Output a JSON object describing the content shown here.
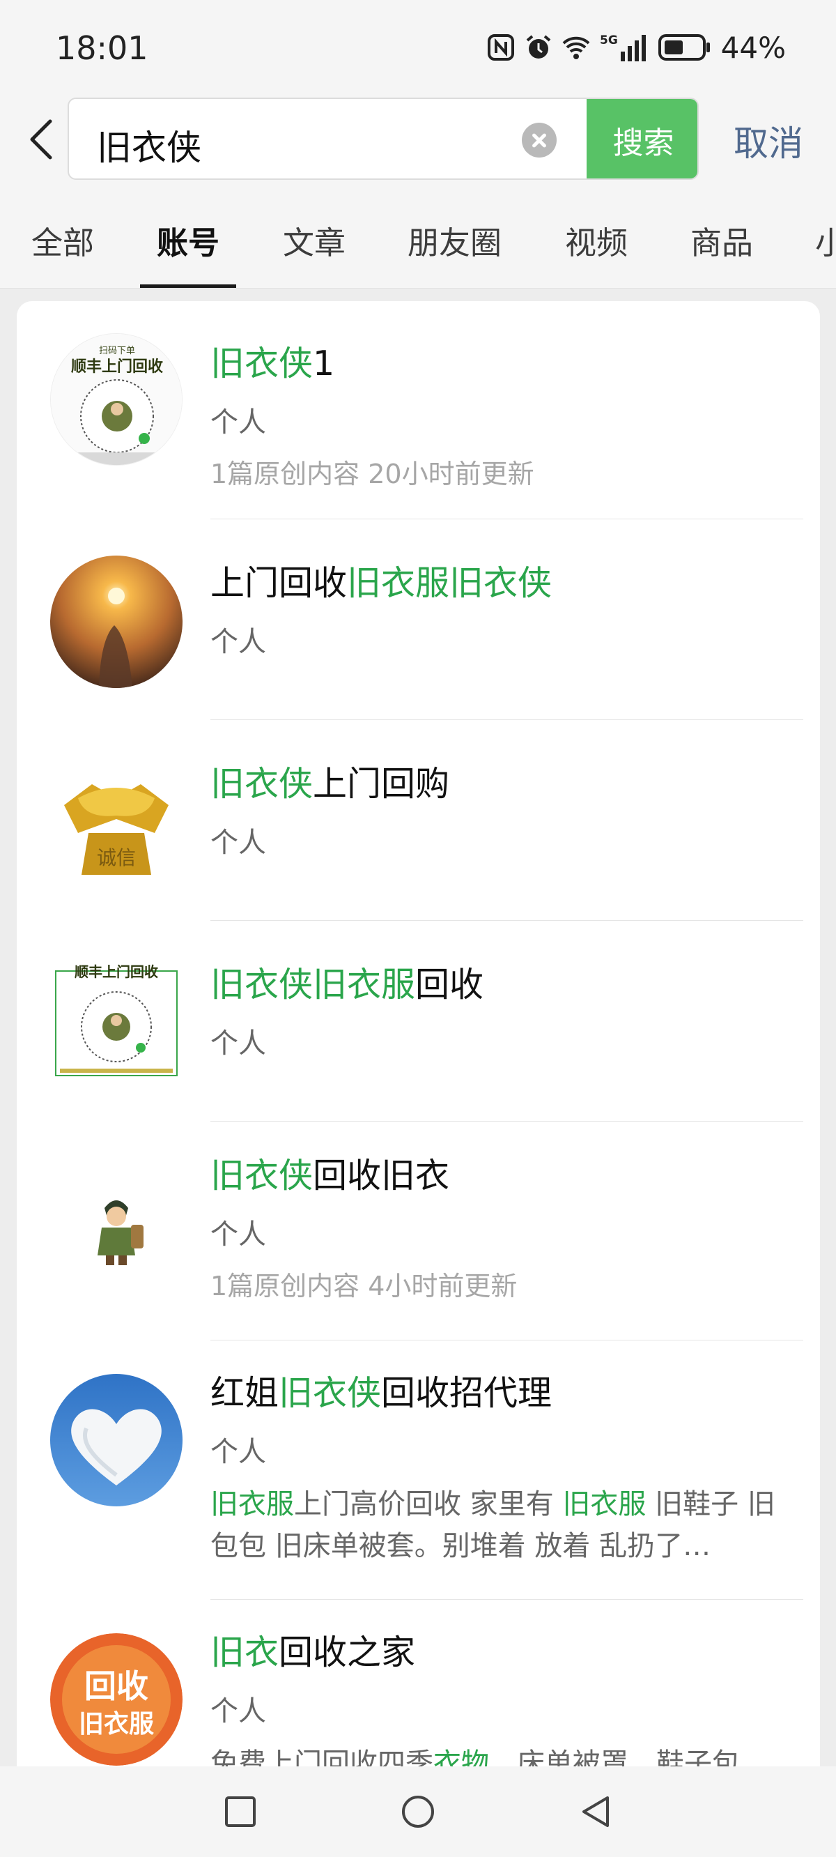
{
  "status_bar": {
    "time": "18:01",
    "network": "5G",
    "battery": "44%"
  },
  "search": {
    "query": "旧衣侠",
    "search_button": "搜索",
    "cancel": "取消"
  },
  "tabs": [
    "全部",
    "账号",
    "文章",
    "朋友圈",
    "视频",
    "商品",
    "小"
  ],
  "active_tab": "账号",
  "results": [
    {
      "name_parts": [
        {
          "t": "旧衣侠",
          "hl": true
        },
        {
          "t": "1",
          "hl": false
        }
      ],
      "type": "个人",
      "meta": "1篇原创内容  20小时前更新",
      "avatar": "qr-code-avatar-icon"
    },
    {
      "name_parts": [
        {
          "t": "上门回收",
          "hl": false
        },
        {
          "t": "旧衣服旧衣侠",
          "hl": true
        }
      ],
      "type": "个人",
      "avatar": "sunset-avatar-icon"
    },
    {
      "name_parts": [
        {
          "t": "旧衣侠",
          "hl": true
        },
        {
          "t": "上门回购",
          "hl": false
        }
      ],
      "type": "个人",
      "avatar": "gold-handshake-avatar-icon"
    },
    {
      "name_parts": [
        {
          "t": "旧衣侠旧衣服",
          "hl": true
        },
        {
          "t": "回收",
          "hl": false
        }
      ],
      "type": "个人",
      "avatar": "qr-code-avatar-icon"
    },
    {
      "name_parts": [
        {
          "t": "旧衣侠",
          "hl": true
        },
        {
          "t": "回收旧衣",
          "hl": false
        }
      ],
      "type": "个人",
      "meta": "1篇原创内容  4小时前更新",
      "avatar": "cartoon-hero-avatar-icon"
    },
    {
      "name_parts": [
        {
          "t": "红姐",
          "hl": false
        },
        {
          "t": "旧衣侠",
          "hl": true
        },
        {
          "t": "回收招代理",
          "hl": false
        }
      ],
      "type": "个人",
      "desc_parts": [
        {
          "t": "旧衣服",
          "hl": true
        },
        {
          "t": "上门高价回收 家里有 ",
          "hl": false
        },
        {
          "t": "旧衣服",
          "hl": true
        },
        {
          "t": " 旧鞋子 旧包包 旧床单被套。别堆着 放着 乱扔了…",
          "hl": false
        }
      ],
      "avatar": "cloud-heart-avatar-icon"
    },
    {
      "name_parts": [
        {
          "t": "旧衣",
          "hl": true
        },
        {
          "t": "回收之家",
          "hl": false
        }
      ],
      "type": "个人",
      "desc_parts": [
        {
          "t": "免费上门回收四季",
          "hl": false
        },
        {
          "t": "衣物",
          "hl": true
        },
        {
          "t": "、床单被罩、鞋子包",
          "hl": false
        }
      ],
      "avatar": "recycle-clothes-badge-avatar-icon",
      "avatar_text": [
        "回收",
        "旧衣服"
      ]
    }
  ],
  "qr_badge": {
    "top": "扫码下单",
    "main": "顺丰上门回收"
  },
  "handshake_badge": "诚信",
  "colors": {
    "accent_green": "#58c266",
    "highlight_green": "#2aa54b",
    "cancel_blue": "#50698e",
    "background": "#ededed"
  }
}
